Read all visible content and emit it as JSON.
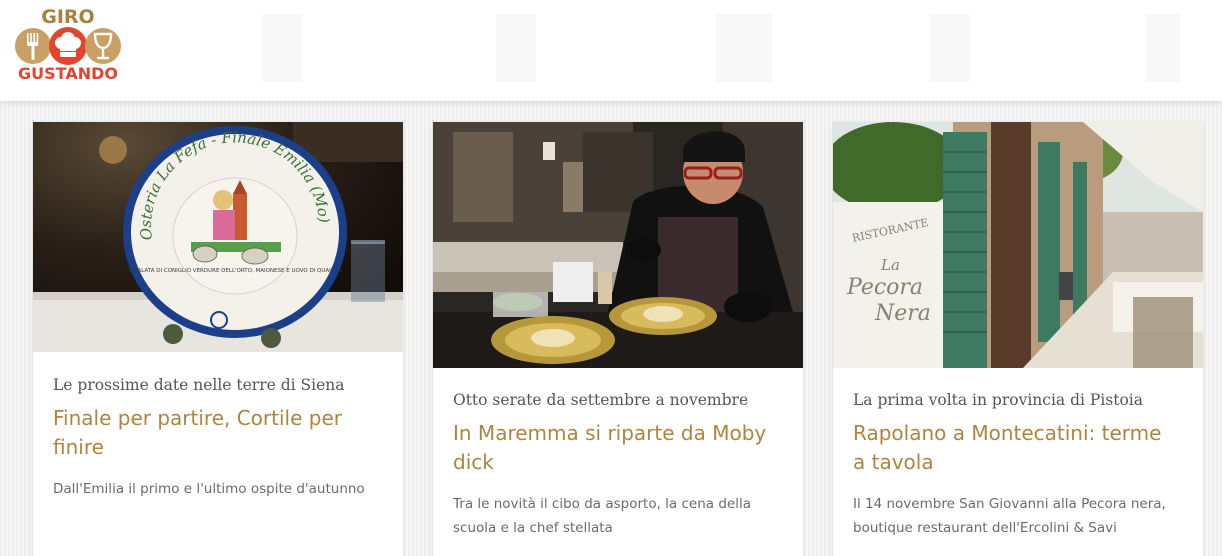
{
  "logo": {
    "top": "GIRO",
    "bottom": "GUSTANDO"
  },
  "articles": [
    {
      "kicker": "Le prossime date nelle terre di Siena",
      "title": "Finale per partire, Cortile per finire",
      "description": "Dall'Emilia il primo e l'ultimo ospite d'autunno",
      "image_text": {
        "plate_rim": "Osteria La Fefa - Finale Emilia (Mo)",
        "plate_caption": "INSALATA DI CONIGLIO VERDURE DELL'ORTO, MAIONESE E UOVO DI QUAGLIA"
      }
    },
    {
      "kicker": "Otto serate da settembre a novembre",
      "title": "In Maremma si riparte da Moby dick",
      "description": "Tra le novità il cibo da asporto, la cena della scuola e la chef stellata"
    },
    {
      "kicker": "La prima volta in provincia di Pistoia",
      "title": "Rapolano a Montecatini: terme a tavola",
      "description": "Il 14 novembre San Giovanni alla Pecora nera, boutique restaurant dell'Ercolini & Savi",
      "image_text": {
        "sign_line1": "RISTORANTE",
        "sign_line2": "La",
        "sign_line3": "Pecora",
        "sign_line4": "Nera"
      }
    }
  ]
}
